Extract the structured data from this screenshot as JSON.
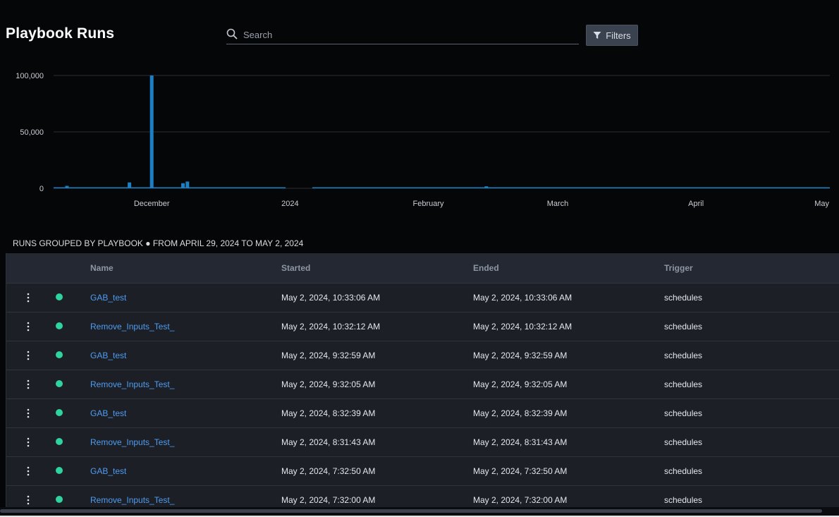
{
  "header": {
    "title": "Playbook Runs",
    "search_placeholder": "Search",
    "filters_label": "Filters"
  },
  "colors": {
    "background": "#050608",
    "bar": "#1a7fc4",
    "link": "#4f9cf0",
    "status_ok": "#2ed3a0"
  },
  "chart_data": {
    "type": "bar",
    "y_ticks": [
      "100,000",
      "50,000",
      "0"
    ],
    "ylim": [
      0,
      100000
    ],
    "x_tick_labels": [
      "December",
      "2024",
      "February",
      "March",
      "April",
      "May"
    ],
    "x_range": [
      "2023-11-09",
      "2024-05-01"
    ],
    "x_ticks": [
      "2023-12-01",
      "2024-01-01",
      "2024-02-01",
      "2024-03-01",
      "2024-04-01",
      "2024-05-01"
    ],
    "series": [
      {
        "points": [
          [
            "2023-11-12",
            2200
          ],
          [
            "2023-11-26",
            5200
          ],
          [
            "2023-12-01",
            100000
          ],
          [
            "2023-12-08",
            4500
          ],
          [
            "2023-12-09",
            6000
          ],
          [
            "2024-02-14",
            1800
          ]
        ],
        "baseline_ranges": [
          [
            "2023-11-09",
            "2023-12-31"
          ],
          [
            "2024-01-06",
            "2024-05-01"
          ]
        ],
        "baseline_value": 300
      }
    ],
    "grid": true
  },
  "caption": "RUNS GROUPED BY PLAYBOOK ● FROM APRIL 29, 2024 TO MAY 2, 2024",
  "table": {
    "columns": [
      "Name",
      "Started",
      "Ended",
      "Trigger"
    ],
    "rows": [
      {
        "name": "GAB_test",
        "started": "May 2, 2024, 10:33:06 AM",
        "ended": "May 2, 2024, 10:33:06 AM",
        "trigger": "schedules"
      },
      {
        "name": "Remove_Inputs_Test_",
        "started": "May 2, 2024, 10:32:12 AM",
        "ended": "May 2, 2024, 10:32:12 AM",
        "trigger": "schedules"
      },
      {
        "name": "GAB_test",
        "started": "May 2, 2024, 9:32:59 AM",
        "ended": "May 2, 2024, 9:32:59 AM",
        "trigger": "schedules"
      },
      {
        "name": "Remove_Inputs_Test_",
        "started": "May 2, 2024, 9:32:05 AM",
        "ended": "May 2, 2024, 9:32:05 AM",
        "trigger": "schedules"
      },
      {
        "name": "GAB_test",
        "started": "May 2, 2024, 8:32:39 AM",
        "ended": "May 2, 2024, 8:32:39 AM",
        "trigger": "schedules"
      },
      {
        "name": "Remove_Inputs_Test_",
        "started": "May 2, 2024, 8:31:43 AM",
        "ended": "May 2, 2024, 8:31:43 AM",
        "trigger": "schedules"
      },
      {
        "name": "GAB_test",
        "started": "May 2, 2024, 7:32:50 AM",
        "ended": "May 2, 2024, 7:32:50 AM",
        "trigger": "schedules"
      },
      {
        "name": "Remove_Inputs_Test_",
        "started": "May 2, 2024, 7:32:00 AM",
        "ended": "May 2, 2024, 7:32:00 AM",
        "trigger": "schedules"
      }
    ]
  }
}
